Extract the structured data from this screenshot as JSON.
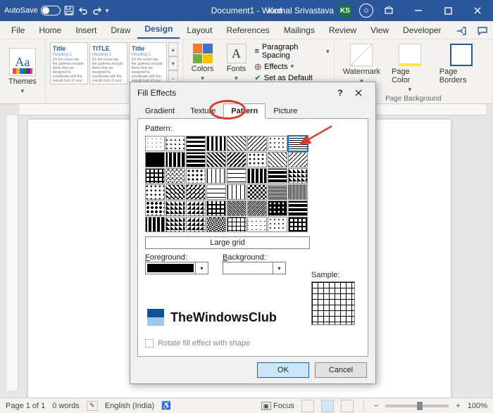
{
  "titlebar": {
    "autosave_label": "AutoSave",
    "autosave_state": "Off",
    "document_title": "Document1 - Word",
    "user_name": "Komal Srivastava",
    "user_initials": "KS"
  },
  "ribbon_tabs": {
    "items": [
      "File",
      "Home",
      "Insert",
      "Draw",
      "Design",
      "Layout",
      "References",
      "Mailings",
      "Review",
      "View",
      "Developer"
    ],
    "active": "Design"
  },
  "ribbon": {
    "themes_label": "Themes",
    "style_cards": [
      {
        "title": "Title",
        "heading": "Heading 1"
      },
      {
        "title": "TITLE",
        "heading": "Heading 1"
      },
      {
        "title": "Title",
        "heading": "Heading 1"
      }
    ],
    "colors_label": "Colors",
    "fonts_label": "Fonts",
    "paragraph_spacing_label": "Paragraph Spacing",
    "effects_label": "Effects",
    "set_as_default_label": "Set as Default",
    "watermark_label": "Watermark",
    "page_color_label": "Page Color",
    "page_borders_label": "Page Borders",
    "page_background_group": "Page Background"
  },
  "dialog": {
    "title": "Fill Effects",
    "tabs": {
      "gradient": "Gradient",
      "texture": "Texture",
      "pattern": "Pattern",
      "picture": "Picture",
      "active": "Pattern"
    },
    "pattern_label": "Pattern:",
    "selected_pattern_name": "Large grid",
    "foreground_label": "Foreground:",
    "background_label": "Background:",
    "foreground_color": "#000000",
    "background_color": "#ffffff",
    "sample_label": "Sample:",
    "rotate_label": "Rotate fill effect with shape",
    "ok_label": "OK",
    "cancel_label": "Cancel"
  },
  "branding": {
    "text": "TheWindowsClub"
  },
  "statusbar": {
    "page_info": "Page 1 of 1",
    "word_count": "0 words",
    "language": "English (India)",
    "focus_label": "Focus",
    "zoom_value": "100%"
  }
}
